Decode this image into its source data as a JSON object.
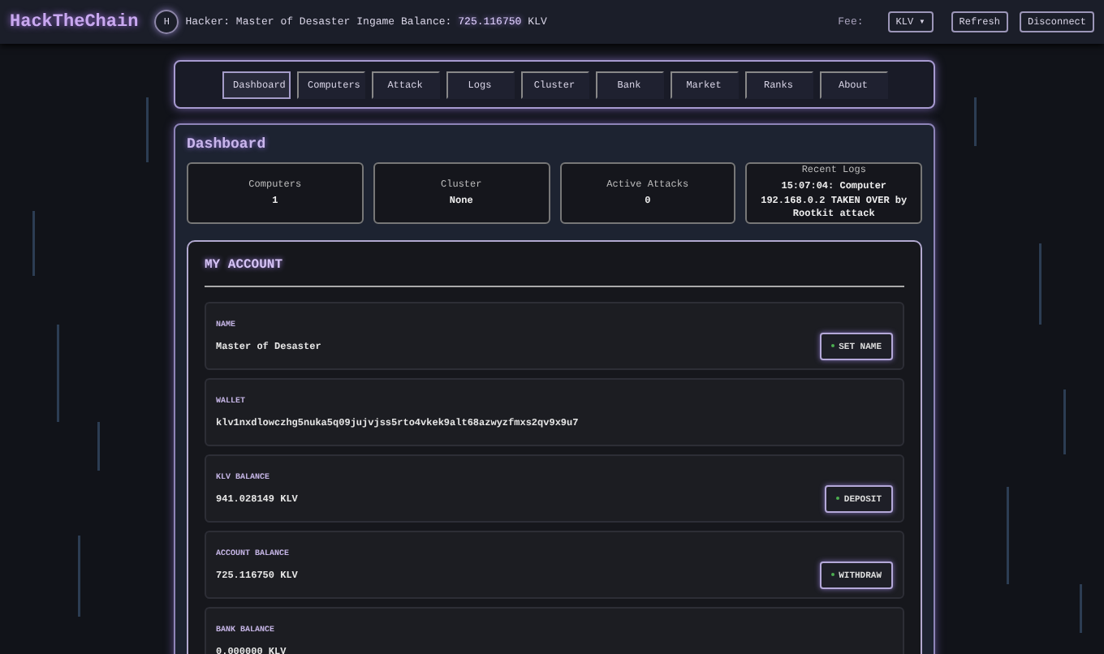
{
  "header": {
    "logo": "HackTheChain",
    "avatar_letter": "H",
    "hacker": "Hacker: Master of Desaster",
    "balance_label": "Ingame Balance:",
    "balance_value": "725.116750",
    "balance_unit": "KLV",
    "fee_label": "Fee:",
    "fee_value": "KLV",
    "fee_caret": "▾",
    "buttons": [
      "Refresh",
      "Disconnect"
    ]
  },
  "nav": [
    {
      "label": "Dashboard",
      "selected": true
    },
    {
      "label": "Computers",
      "selected": false
    },
    {
      "label": "Attack",
      "selected": false
    },
    {
      "label": "Logs",
      "selected": false
    },
    {
      "label": "Cluster",
      "selected": false
    },
    {
      "label": "Bank",
      "selected": false
    },
    {
      "label": "Market",
      "selected": false
    },
    {
      "label": "Ranks",
      "selected": false
    },
    {
      "label": "About",
      "selected": false
    }
  ],
  "page_title": "Dashboard",
  "stats": [
    {
      "label": "Computers",
      "value": "1"
    },
    {
      "label": "Cluster",
      "value": "None"
    },
    {
      "label": "Active Attacks",
      "value": "0"
    },
    {
      "label": "Recent Logs",
      "value": "15:07:04: Computer 192.168.0.2 TAKEN OVER by Rootkit attack"
    }
  ],
  "account": {
    "title": "MY ACCOUNT",
    "fields": [
      {
        "label": "NAME",
        "value": "Master of Desaster",
        "action": "SET NAME"
      },
      {
        "label": "WALLET",
        "value": "klv1nxdlowczhg5nuka5q09jujvjss5rto4vkek9alt68azwyzfmxs2qv9x9u7"
      },
      {
        "label": "KLV BALANCE",
        "value": "941.028149 KLV",
        "action": "DEPOSIT"
      },
      {
        "label": "ACCOUNT BALANCE",
        "value": "725.116750 KLV",
        "action": "WITHDRAW"
      },
      {
        "label": "BANK BALANCE",
        "value": "0.000000 KLV"
      }
    ]
  }
}
